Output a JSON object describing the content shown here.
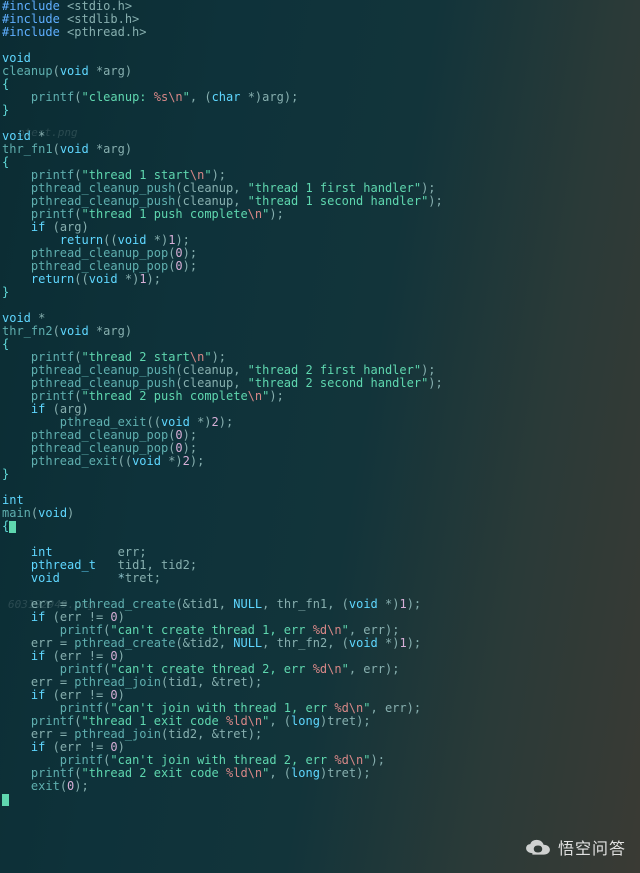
{
  "watermarks": {
    "wm1": "ptest.png",
    "wm2": "603192949.png"
  },
  "logo": {
    "text": "悟空问答"
  },
  "code": {
    "lines": [
      [
        [
          "inc",
          "#include"
        ],
        [
          "pun",
          " <stdio.h>"
        ]
      ],
      [
        [
          "inc",
          "#include"
        ],
        [
          "pun",
          " <stdlib.h>"
        ]
      ],
      [
        [
          "inc",
          "#include"
        ],
        [
          "pun",
          " <pthread.h>"
        ]
      ],
      [
        [
          "",
          "  "
        ]
      ],
      [
        [
          "kw",
          "void"
        ]
      ],
      [
        [
          "fn",
          "cleanup"
        ],
        [
          "pun",
          "("
        ],
        [
          "kw",
          "void"
        ],
        [
          "pun",
          " *"
        ],
        [
          "id",
          "arg"
        ],
        [
          "pun",
          ")"
        ]
      ],
      [
        [
          "brace",
          "{"
        ]
      ],
      [
        [
          "",
          "    "
        ],
        [
          "fn",
          "printf"
        ],
        [
          "pun",
          "("
        ],
        [
          "str",
          "\"cleanup: "
        ],
        [
          "esc",
          "%s\\n"
        ],
        [
          "str",
          "\""
        ],
        [
          "pun",
          ", ("
        ],
        [
          "kw",
          "char"
        ],
        [
          "pun",
          " *)"
        ],
        [
          "id",
          "arg"
        ],
        [
          "pun",
          ");"
        ]
      ],
      [
        [
          "brace",
          "}"
        ]
      ],
      [
        [
          "",
          "  "
        ]
      ],
      [
        [
          "kw",
          "void"
        ],
        [
          "pun",
          " *"
        ]
      ],
      [
        [
          "fn",
          "thr_fn1"
        ],
        [
          "pun",
          "("
        ],
        [
          "kw",
          "void"
        ],
        [
          "pun",
          " *"
        ],
        [
          "id",
          "arg"
        ],
        [
          "pun",
          ")"
        ]
      ],
      [
        [
          "brace",
          "{"
        ]
      ],
      [
        [
          "",
          "    "
        ],
        [
          "fn",
          "printf"
        ],
        [
          "pun",
          "("
        ],
        [
          "str",
          "\"thread 1 start"
        ],
        [
          "esc",
          "\\n"
        ],
        [
          "str",
          "\""
        ],
        [
          "pun",
          ");"
        ]
      ],
      [
        [
          "",
          "    "
        ],
        [
          "fn",
          "pthread_cleanup_push"
        ],
        [
          "pun",
          "("
        ],
        [
          "id",
          "cleanup"
        ],
        [
          "pun",
          ", "
        ],
        [
          "str",
          "\"thread 1 first handler\""
        ],
        [
          "pun",
          ");"
        ]
      ],
      [
        [
          "",
          "    "
        ],
        [
          "fn",
          "pthread_cleanup_push"
        ],
        [
          "pun",
          "("
        ],
        [
          "id",
          "cleanup"
        ],
        [
          "pun",
          ", "
        ],
        [
          "str",
          "\"thread 1 second handler\""
        ],
        [
          "pun",
          ");"
        ]
      ],
      [
        [
          "",
          "    "
        ],
        [
          "fn",
          "printf"
        ],
        [
          "pun",
          "("
        ],
        [
          "str",
          "\"thread 1 push complete"
        ],
        [
          "esc",
          "\\n"
        ],
        [
          "str",
          "\""
        ],
        [
          "pun",
          ");"
        ]
      ],
      [
        [
          "",
          "    "
        ],
        [
          "kw",
          "if"
        ],
        [
          "pun",
          " ("
        ],
        [
          "id",
          "arg"
        ],
        [
          "pun",
          ")"
        ]
      ],
      [
        [
          "",
          "        "
        ],
        [
          "kw",
          "return"
        ],
        [
          "pun",
          "(("
        ],
        [
          "kw",
          "void"
        ],
        [
          "pun",
          " *)"
        ],
        [
          "num",
          "1"
        ],
        [
          "pun",
          ");"
        ]
      ],
      [
        [
          "",
          "    "
        ],
        [
          "fn",
          "pthread_cleanup_pop"
        ],
        [
          "pun",
          "("
        ],
        [
          "num",
          "0"
        ],
        [
          "pun",
          ");"
        ]
      ],
      [
        [
          "",
          "    "
        ],
        [
          "fn",
          "pthread_cleanup_pop"
        ],
        [
          "pun",
          "("
        ],
        [
          "num",
          "0"
        ],
        [
          "pun",
          ");"
        ]
      ],
      [
        [
          "",
          "    "
        ],
        [
          "kw",
          "return"
        ],
        [
          "pun",
          "(("
        ],
        [
          "kw",
          "void"
        ],
        [
          "pun",
          " *)"
        ],
        [
          "num",
          "1"
        ],
        [
          "pun",
          ");"
        ]
      ],
      [
        [
          "brace",
          "}"
        ]
      ],
      [
        [
          "",
          "  "
        ]
      ],
      [
        [
          "kw",
          "void"
        ],
        [
          "pun",
          " *"
        ]
      ],
      [
        [
          "fn",
          "thr_fn2"
        ],
        [
          "pun",
          "("
        ],
        [
          "kw",
          "void"
        ],
        [
          "pun",
          " *"
        ],
        [
          "id",
          "arg"
        ],
        [
          "pun",
          ")"
        ]
      ],
      [
        [
          "brace",
          "{"
        ]
      ],
      [
        [
          "",
          "    "
        ],
        [
          "fn",
          "printf"
        ],
        [
          "pun",
          "("
        ],
        [
          "str",
          "\"thread 2 start"
        ],
        [
          "esc",
          "\\n"
        ],
        [
          "str",
          "\""
        ],
        [
          "pun",
          ");"
        ]
      ],
      [
        [
          "",
          "    "
        ],
        [
          "fn",
          "pthread_cleanup_push"
        ],
        [
          "pun",
          "("
        ],
        [
          "id",
          "cleanup"
        ],
        [
          "pun",
          ", "
        ],
        [
          "str",
          "\"thread 2 first handler\""
        ],
        [
          "pun",
          ");"
        ]
      ],
      [
        [
          "",
          "    "
        ],
        [
          "fn",
          "pthread_cleanup_push"
        ],
        [
          "pun",
          "("
        ],
        [
          "id",
          "cleanup"
        ],
        [
          "pun",
          ", "
        ],
        [
          "str",
          "\"thread 2 second handler\""
        ],
        [
          "pun",
          ");"
        ]
      ],
      [
        [
          "",
          "    "
        ],
        [
          "fn",
          "printf"
        ],
        [
          "pun",
          "("
        ],
        [
          "str",
          "\"thread 2 push complete"
        ],
        [
          "esc",
          "\\n"
        ],
        [
          "str",
          "\""
        ],
        [
          "pun",
          ");"
        ]
      ],
      [
        [
          "",
          "    "
        ],
        [
          "kw",
          "if"
        ],
        [
          "pun",
          " ("
        ],
        [
          "id",
          "arg"
        ],
        [
          "pun",
          ")"
        ]
      ],
      [
        [
          "",
          "        "
        ],
        [
          "fn",
          "pthread_exit"
        ],
        [
          "pun",
          "(("
        ],
        [
          "kw",
          "void"
        ],
        [
          "pun",
          " *)"
        ],
        [
          "num",
          "2"
        ],
        [
          "pun",
          ");"
        ]
      ],
      [
        [
          "",
          "    "
        ],
        [
          "fn",
          "pthread_cleanup_pop"
        ],
        [
          "pun",
          "("
        ],
        [
          "num",
          "0"
        ],
        [
          "pun",
          ");"
        ]
      ],
      [
        [
          "",
          "    "
        ],
        [
          "fn",
          "pthread_cleanup_pop"
        ],
        [
          "pun",
          "("
        ],
        [
          "num",
          "0"
        ],
        [
          "pun",
          ");"
        ]
      ],
      [
        [
          "",
          "    "
        ],
        [
          "fn",
          "pthread_exit"
        ],
        [
          "pun",
          "(("
        ],
        [
          "kw",
          "void"
        ],
        [
          "pun",
          " *)"
        ],
        [
          "num",
          "2"
        ],
        [
          "pun",
          ");"
        ]
      ],
      [
        [
          "brace",
          "}"
        ]
      ],
      [
        [
          "",
          "  "
        ]
      ],
      [
        [
          "kw",
          "int"
        ]
      ],
      [
        [
          "fn",
          "main"
        ],
        [
          "pun",
          "("
        ],
        [
          "kw",
          "void"
        ],
        [
          "pun",
          ")"
        ]
      ],
      [
        [
          "brace",
          "{"
        ],
        [
          "cursor",
          ""
        ]
      ],
      [
        [
          "",
          "  "
        ]
      ],
      [
        [
          "",
          "    "
        ],
        [
          "kw",
          "int"
        ],
        [
          "",
          "         "
        ],
        [
          "id",
          "err"
        ],
        [
          "pun",
          ";"
        ]
      ],
      [
        [
          "",
          "    "
        ],
        [
          "kw",
          "pthread_t"
        ],
        [
          "",
          "   "
        ],
        [
          "id",
          "tid1"
        ],
        [
          "pun",
          ", "
        ],
        [
          "id",
          "tid2"
        ],
        [
          "pun",
          ";"
        ]
      ],
      [
        [
          "",
          "    "
        ],
        [
          "kw",
          "void"
        ],
        [
          "",
          "        *"
        ],
        [
          "id",
          "tret"
        ],
        [
          "pun",
          ";"
        ]
      ],
      [
        [
          "",
          "  "
        ]
      ],
      [
        [
          "",
          "    "
        ],
        [
          "id",
          "err"
        ],
        [
          "pun",
          " = "
        ],
        [
          "fn",
          "pthread_create"
        ],
        [
          "pun",
          "(&"
        ],
        [
          "id",
          "tid1"
        ],
        [
          "pun",
          ", "
        ],
        [
          "kw",
          "NULL"
        ],
        [
          "pun",
          ", "
        ],
        [
          "id",
          "thr_fn1"
        ],
        [
          "pun",
          ", ("
        ],
        [
          "kw",
          "void"
        ],
        [
          "pun",
          " *)"
        ],
        [
          "num",
          "1"
        ],
        [
          "pun",
          ");"
        ]
      ],
      [
        [
          "",
          "    "
        ],
        [
          "kw",
          "if"
        ],
        [
          "pun",
          " ("
        ],
        [
          "id",
          "err"
        ],
        [
          "pun",
          " != "
        ],
        [
          "num",
          "0"
        ],
        [
          "pun",
          ")"
        ]
      ],
      [
        [
          "",
          "        "
        ],
        [
          "fn",
          "printf"
        ],
        [
          "pun",
          "("
        ],
        [
          "str",
          "\"can't create thread 1, err "
        ],
        [
          "esc",
          "%d\\n"
        ],
        [
          "str",
          "\""
        ],
        [
          "pun",
          ", "
        ],
        [
          "id",
          "err"
        ],
        [
          "pun",
          ");"
        ]
      ],
      [
        [
          "",
          "    "
        ],
        [
          "id",
          "err"
        ],
        [
          "pun",
          " = "
        ],
        [
          "fn",
          "pthread_create"
        ],
        [
          "pun",
          "(&"
        ],
        [
          "id",
          "tid2"
        ],
        [
          "pun",
          ", "
        ],
        [
          "kw",
          "NULL"
        ],
        [
          "pun",
          ", "
        ],
        [
          "id",
          "thr_fn2"
        ],
        [
          "pun",
          ", ("
        ],
        [
          "kw",
          "void"
        ],
        [
          "pun",
          " *)"
        ],
        [
          "num",
          "1"
        ],
        [
          "pun",
          ");"
        ]
      ],
      [
        [
          "",
          "    "
        ],
        [
          "kw",
          "if"
        ],
        [
          "pun",
          " ("
        ],
        [
          "id",
          "err"
        ],
        [
          "pun",
          " != "
        ],
        [
          "num",
          "0"
        ],
        [
          "pun",
          ")"
        ]
      ],
      [
        [
          "",
          "        "
        ],
        [
          "fn",
          "printf"
        ],
        [
          "pun",
          "("
        ],
        [
          "str",
          "\"can't create thread 2, err "
        ],
        [
          "esc",
          "%d\\n"
        ],
        [
          "str",
          "\""
        ],
        [
          "pun",
          ", "
        ],
        [
          "id",
          "err"
        ],
        [
          "pun",
          ");"
        ]
      ],
      [
        [
          "",
          "    "
        ],
        [
          "id",
          "err"
        ],
        [
          "pun",
          " = "
        ],
        [
          "fn",
          "pthread_join"
        ],
        [
          "pun",
          "("
        ],
        [
          "id",
          "tid1"
        ],
        [
          "pun",
          ", &"
        ],
        [
          "id",
          "tret"
        ],
        [
          "pun",
          ");"
        ]
      ],
      [
        [
          "",
          "    "
        ],
        [
          "kw",
          "if"
        ],
        [
          "pun",
          " ("
        ],
        [
          "id",
          "err"
        ],
        [
          "pun",
          " != "
        ],
        [
          "num",
          "0"
        ],
        [
          "pun",
          ")"
        ]
      ],
      [
        [
          "",
          "        "
        ],
        [
          "fn",
          "printf"
        ],
        [
          "pun",
          "("
        ],
        [
          "str",
          "\"can't join with thread 1, err "
        ],
        [
          "esc",
          "%d\\n"
        ],
        [
          "str",
          "\""
        ],
        [
          "pun",
          ", "
        ],
        [
          "id",
          "err"
        ],
        [
          "pun",
          ");"
        ]
      ],
      [
        [
          "",
          "    "
        ],
        [
          "fn",
          "printf"
        ],
        [
          "pun",
          "("
        ],
        [
          "str",
          "\"thread 1 exit code "
        ],
        [
          "esc",
          "%ld\\n"
        ],
        [
          "str",
          "\""
        ],
        [
          "pun",
          ", ("
        ],
        [
          "kw",
          "long"
        ],
        [
          "pun",
          ")"
        ],
        [
          "id",
          "tret"
        ],
        [
          "pun",
          ");"
        ]
      ],
      [
        [
          "",
          "    "
        ],
        [
          "id",
          "err"
        ],
        [
          "pun",
          " = "
        ],
        [
          "fn",
          "pthread_join"
        ],
        [
          "pun",
          "("
        ],
        [
          "id",
          "tid2"
        ],
        [
          "pun",
          ", &"
        ],
        [
          "id",
          "tret"
        ],
        [
          "pun",
          ");"
        ]
      ],
      [
        [
          "",
          "    "
        ],
        [
          "kw",
          "if"
        ],
        [
          "pun",
          " ("
        ],
        [
          "id",
          "err"
        ],
        [
          "pun",
          " != "
        ],
        [
          "num",
          "0"
        ],
        [
          "pun",
          ")"
        ]
      ],
      [
        [
          "",
          "        "
        ],
        [
          "fn",
          "printf"
        ],
        [
          "pun",
          "("
        ],
        [
          "str",
          "\"can't join with thread 2, err "
        ],
        [
          "esc",
          "%d\\n"
        ],
        [
          "str",
          "\""
        ],
        [
          "pun",
          ");"
        ]
      ],
      [
        [
          "",
          "    "
        ],
        [
          "fn",
          "printf"
        ],
        [
          "pun",
          "("
        ],
        [
          "str",
          "\"thread 2 exit code "
        ],
        [
          "esc",
          "%ld\\n"
        ],
        [
          "str",
          "\""
        ],
        [
          "pun",
          ", ("
        ],
        [
          "kw",
          "long"
        ],
        [
          "pun",
          ")"
        ],
        [
          "id",
          "tret"
        ],
        [
          "pun",
          ");"
        ]
      ],
      [
        [
          "",
          "    "
        ],
        [
          "fn",
          "exit"
        ],
        [
          "pun",
          "("
        ],
        [
          "num",
          "0"
        ],
        [
          "pun",
          ");"
        ]
      ],
      [
        [
          "cursor",
          ""
        ]
      ]
    ]
  }
}
